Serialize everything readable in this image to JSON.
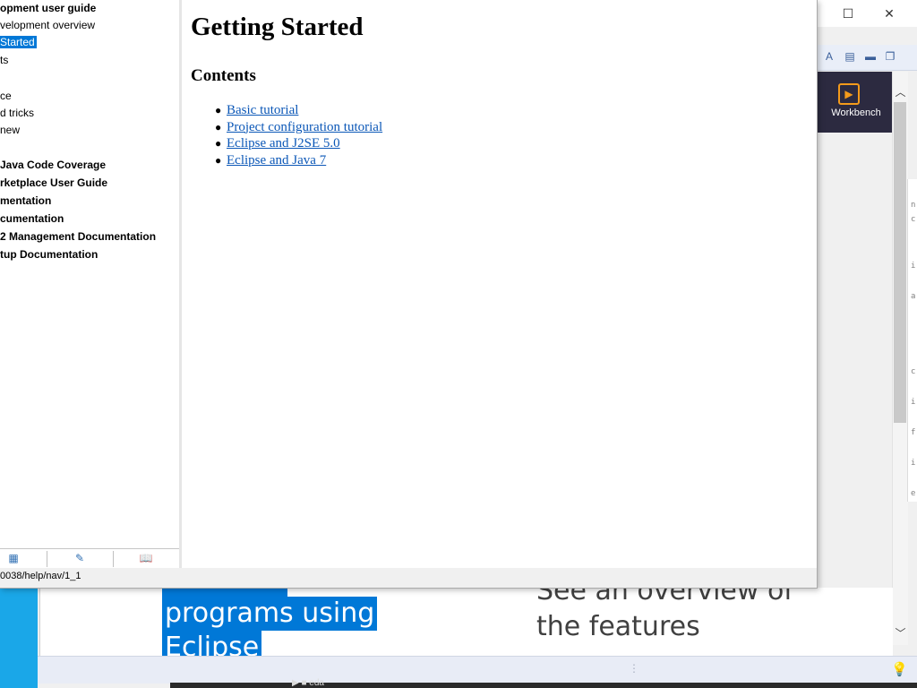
{
  "help": {
    "toc": {
      "items": [
        {
          "label": "opment user guide",
          "bold": true,
          "selected": false
        },
        {
          "label": "velopment overview",
          "bold": false,
          "selected": false
        },
        {
          "label": " Started",
          "bold": false,
          "selected": true
        },
        {
          "label": "ts",
          "bold": false,
          "selected": false
        },
        {
          "label": "ce",
          "bold": false,
          "selected": false
        },
        {
          "label": "d tricks",
          "bold": false,
          "selected": false
        },
        {
          "label": "new",
          "bold": false,
          "selected": false
        },
        {
          "label": "Java Code Coverage",
          "bold": true,
          "selected": false
        },
        {
          "label": "rketplace User Guide",
          "bold": true,
          "selected": false
        },
        {
          "label": "mentation",
          "bold": true,
          "selected": false
        },
        {
          "label": "cumentation",
          "bold": true,
          "selected": false
        },
        {
          "label": "2 Management Documentation",
          "bold": true,
          "selected": false
        },
        {
          "label": "tup Documentation",
          "bold": true,
          "selected": false
        }
      ]
    },
    "status_url": "0038/help/nav/1_1",
    "content": {
      "title": "Getting Started",
      "subtitle": "Contents",
      "links": [
        "Basic tutorial",
        "Project configuration tutorial",
        "Eclipse and J2SE 5.0",
        "Eclipse and Java 7"
      ]
    }
  },
  "workbench": {
    "welcome_tile_label": "Workbench",
    "selected_text": {
      "line1": "programs using",
      "line2": "Eclipse"
    },
    "overview_text": {
      "line1": "See an overview of",
      "line2": "the features"
    },
    "taskbar_label": "eda"
  }
}
